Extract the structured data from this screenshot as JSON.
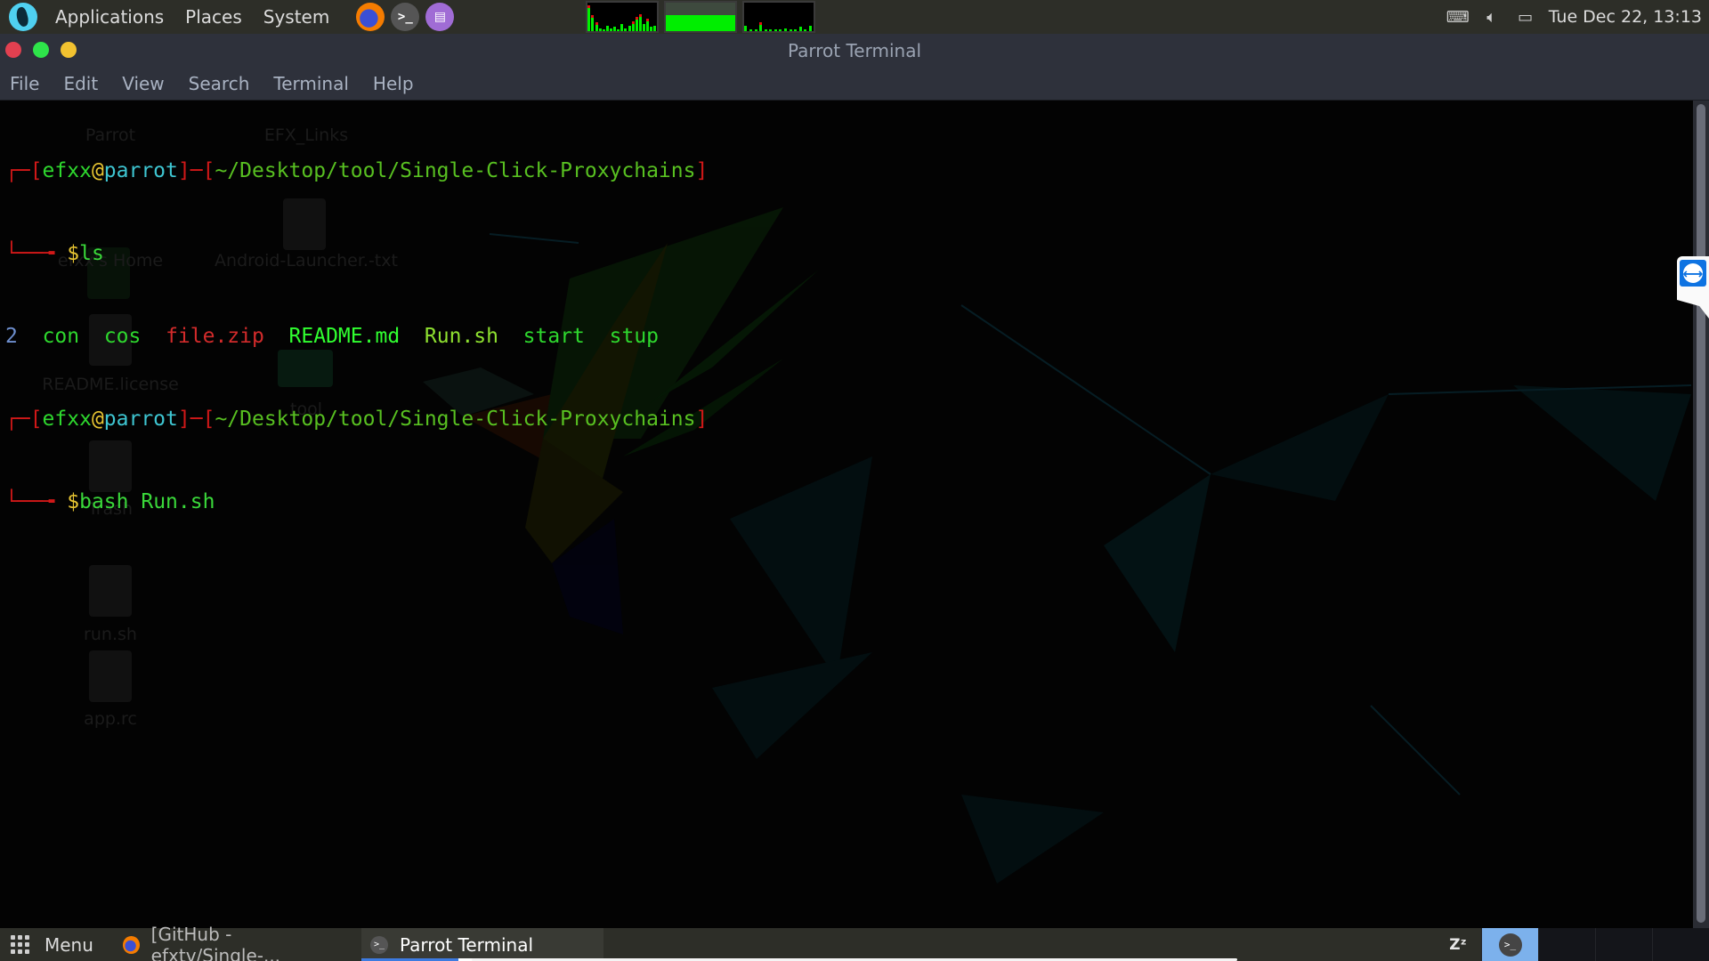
{
  "top_panel": {
    "menus": [
      "Applications",
      "Places",
      "System"
    ],
    "launchers": [
      {
        "name": "firefox",
        "icon": "firefox-icon"
      },
      {
        "name": "terminal",
        "icon": "terminal-icon",
        "glyph": ">_"
      },
      {
        "name": "text-editor",
        "icon": "text-editor-icon",
        "glyph": "▤"
      }
    ],
    "system_monitor": {
      "cpu_load": [
        0.9,
        0.55,
        0.3,
        0.1,
        0.05,
        0.2,
        0.08,
        0.15,
        0.05,
        0.25,
        0.1,
        0.2,
        0.35,
        0.5,
        0.6,
        0.25,
        0.45,
        0.15,
        0.2
      ],
      "memory_used": 0.55,
      "network_load": [
        0.2,
        0.05,
        0.05,
        0.3,
        0.05,
        0.05,
        0.05,
        0.05,
        0.08,
        0.05,
        0.05,
        0.15,
        0.05,
        0.2
      ]
    },
    "tray": {
      "keyboard_icon": "keyboard-icon",
      "volume_icon": "volume-icon",
      "display_icon": "display-icon",
      "clock": "Tue Dec 22, 13:13"
    }
  },
  "window": {
    "title": "Parrot Terminal",
    "menu": [
      "File",
      "Edit",
      "View",
      "Search",
      "Terminal",
      "Help"
    ]
  },
  "terminal": {
    "prompt": {
      "user": "efxx",
      "at": "@",
      "host": "parrot",
      "cwd": "~/Desktop/tool/Single-Click-Proxychains",
      "symbol": "$"
    },
    "commands": [
      "ls",
      "bash Run.sh"
    ],
    "ls_output": [
      {
        "name": "2",
        "kind": "number"
      },
      {
        "name": "con",
        "kind": "exec"
      },
      {
        "name": "cos",
        "kind": "exec"
      },
      {
        "name": "file.zip",
        "kind": "archive"
      },
      {
        "name": "README.md",
        "kind": "bright"
      },
      {
        "name": "Run.sh",
        "kind": "script"
      },
      {
        "name": "start",
        "kind": "exec"
      },
      {
        "name": "stup",
        "kind": "exec"
      }
    ]
  },
  "desktop_icons": [
    "Parrot",
    "EFX_Links",
    "efxx's Home",
    "Android-Launcher.-txt",
    "README.license",
    "tool",
    "Trash",
    "run.sh",
    "app.rc"
  ],
  "taskbar": {
    "menu_label": "Menu",
    "tasks": [
      {
        "label": "[GitHub - efxtv/Single-...",
        "icon": "firefox-icon",
        "active": false
      },
      {
        "label": "Parrot Terminal",
        "icon": "terminal-icon",
        "active": true
      }
    ],
    "sleep_glyph": "Zᶻ",
    "workspaces": 4,
    "active_workspace": 1
  },
  "colors": {
    "panel": "#2d2e28",
    "titlebar": "#2e313b",
    "close": "#e24050",
    "maximize": "#2ee44a",
    "minimize": "#f2c230",
    "workspace_active": "#7cb1ec"
  }
}
